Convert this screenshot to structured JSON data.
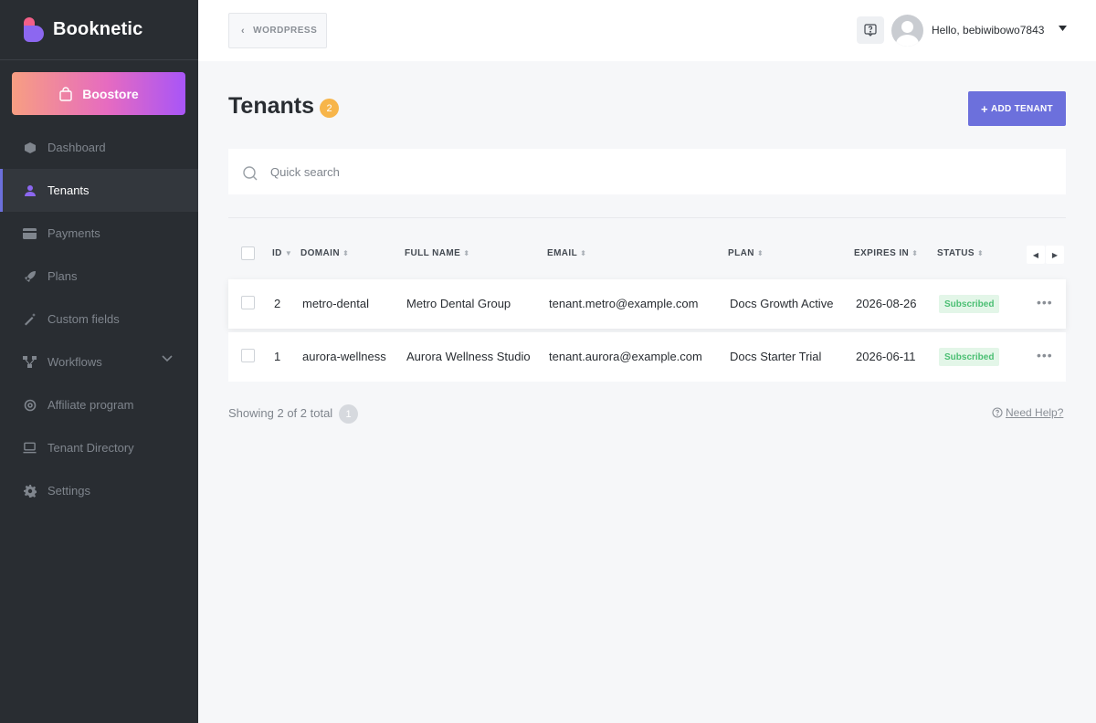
{
  "brand": {
    "name": "Booknetic"
  },
  "boostore": {
    "label": "Boostore"
  },
  "sidebar": {
    "items": [
      {
        "label": "Dashboard",
        "icon": "dashboard-icon"
      },
      {
        "label": "Tenants",
        "icon": "user-icon",
        "active": true
      },
      {
        "label": "Payments",
        "icon": "credit-card-icon"
      },
      {
        "label": "Plans",
        "icon": "rocket-icon"
      },
      {
        "label": "Custom fields",
        "icon": "magic-wand-icon"
      },
      {
        "label": "Workflows",
        "icon": "workflow-icon",
        "has_chevron": true
      },
      {
        "label": "Affiliate program",
        "icon": "target-icon"
      },
      {
        "label": "Tenant Directory",
        "icon": "laptop-icon"
      },
      {
        "label": "Settings",
        "icon": "gear-icon"
      }
    ]
  },
  "topbar": {
    "wordpress_label": "WORDPRESS",
    "user_greeting": "Hello, bebiwibowo7843"
  },
  "page": {
    "title": "Tenants",
    "count": "2",
    "add_button": "ADD TENANT"
  },
  "search": {
    "placeholder": "Quick search",
    "value": ""
  },
  "table": {
    "columns": [
      "ID",
      "DOMAIN",
      "FULL NAME",
      "EMAIL",
      "PLAN",
      "EXPIRES IN",
      "STATUS"
    ],
    "rows": [
      {
        "id": "2",
        "domain": "metro-dental",
        "full_name": "Metro Dental Group",
        "email": "tenant.metro@example.com",
        "plan": "Docs Growth Active",
        "expires_in": "2026-08-26",
        "status": "Subscribed"
      },
      {
        "id": "1",
        "domain": "aurora-wellness",
        "full_name": "Aurora Wellness Studio",
        "email": "tenant.aurora@example.com",
        "plan": "Docs Starter Trial",
        "expires_in": "2026-06-11",
        "status": "Subscribed"
      }
    ]
  },
  "footer": {
    "showing_text": "Showing 2 of 2 total",
    "current_page": "1",
    "help_link": "Need Help?"
  },
  "colors": {
    "sidebar_bg": "#292d32",
    "accent": "#6c70dc",
    "badge": "#f7b54a",
    "status_green": "#4bbf73"
  }
}
